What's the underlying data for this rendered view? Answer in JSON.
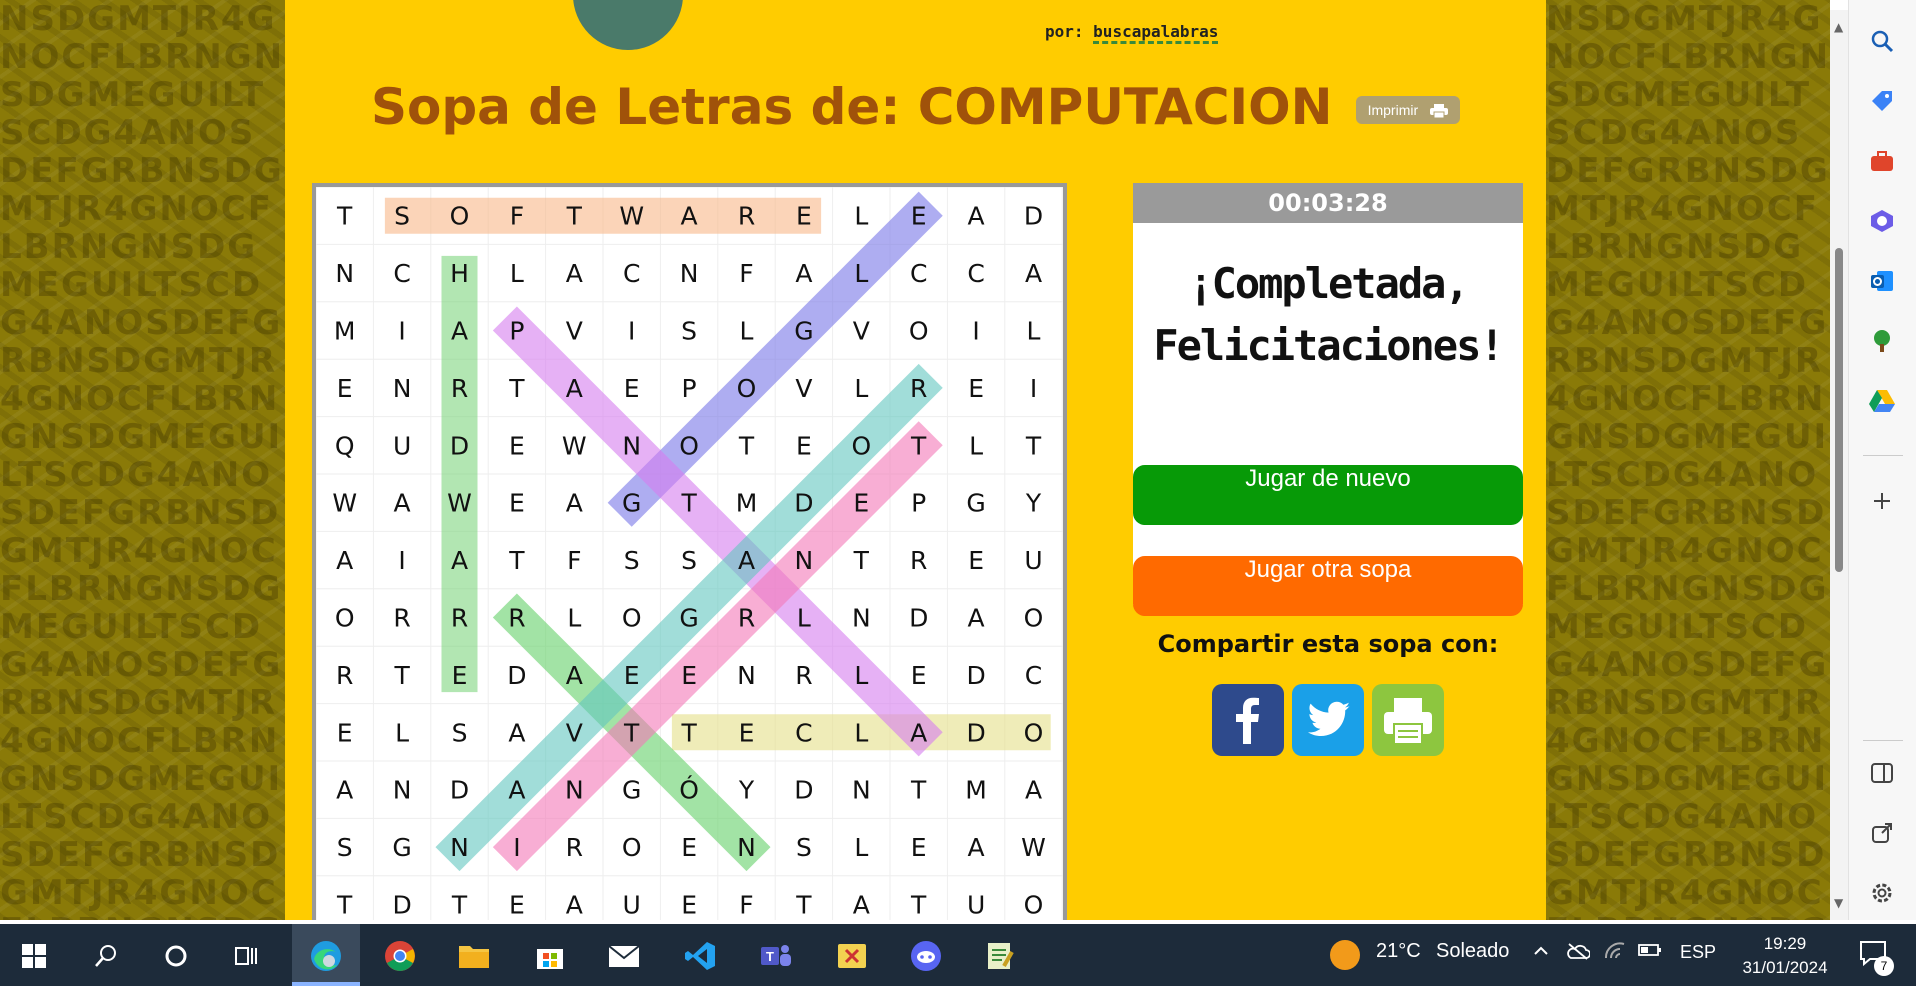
{
  "logo": {
    "by_label": "por:",
    "brand": "buscapalabras"
  },
  "title": "Sopa de Letras de: COMPUTACION",
  "print_button": "Imprimir",
  "grid": {
    "rows": [
      [
        "T",
        "S",
        "O",
        "F",
        "T",
        "W",
        "A",
        "R",
        "E",
        "L",
        "E",
        "A",
        "D"
      ],
      [
        "N",
        "C",
        "H",
        "L",
        "A",
        "C",
        "N",
        "F",
        "A",
        "L",
        "C",
        "C",
        "A"
      ],
      [
        "M",
        "I",
        "A",
        "P",
        "V",
        "I",
        "S",
        "L",
        "G",
        "V",
        "O",
        "I",
        "L"
      ],
      [
        "E",
        "N",
        "R",
        "T",
        "A",
        "E",
        "P",
        "O",
        "V",
        "L",
        "R",
        "E",
        "I"
      ],
      [
        "Q",
        "U",
        "D",
        "E",
        "W",
        "N",
        "O",
        "T",
        "E",
        "O",
        "T",
        "L",
        "T"
      ],
      [
        "W",
        "A",
        "W",
        "E",
        "A",
        "G",
        "T",
        "M",
        "D",
        "E",
        "P",
        "G",
        "Y"
      ],
      [
        "A",
        "I",
        "A",
        "T",
        "F",
        "S",
        "S",
        "A",
        "N",
        "T",
        "R",
        "E",
        "U"
      ],
      [
        "O",
        "R",
        "R",
        "R",
        "L",
        "O",
        "G",
        "R",
        "L",
        "N",
        "D",
        "A",
        "O"
      ],
      [
        "R",
        "T",
        "E",
        "D",
        "A",
        "E",
        "E",
        "N",
        "R",
        "L",
        "E",
        "D",
        "C"
      ],
      [
        "E",
        "L",
        "S",
        "A",
        "V",
        "T",
        "T",
        "E",
        "C",
        "L",
        "A",
        "D",
        "O"
      ],
      [
        "A",
        "N",
        "D",
        "A",
        "N",
        "G",
        "Ó",
        "Y",
        "D",
        "N",
        "T",
        "M",
        "A"
      ],
      [
        "S",
        "G",
        "N",
        "I",
        "R",
        "O",
        "E",
        "N",
        "S",
        "L",
        "E",
        "A",
        "W"
      ],
      [
        "T",
        "D",
        "T",
        "E",
        "A",
        "U",
        "E",
        "F",
        "T",
        "A",
        "T",
        "U",
        "O"
      ]
    ],
    "highlights": [
      {
        "word": "SOFTWARE",
        "from": [
          0,
          1
        ],
        "to": [
          0,
          8
        ],
        "color": "#f9b98a"
      },
      {
        "word": "HARDWARE",
        "from": [
          1,
          2
        ],
        "to": [
          8,
          2
        ],
        "color": "#7fd67f"
      },
      {
        "word": "TECLADO",
        "from": [
          9,
          6
        ],
        "to": [
          9,
          12
        ],
        "color": "#e6e08a"
      },
      {
        "word": "GOOGLE",
        "from": [
          5,
          5
        ],
        "to": [
          0,
          10
        ],
        "color": "#7a78e8"
      },
      {
        "word": "PANTALLA",
        "from": [
          2,
          3
        ],
        "to": [
          9,
          10
        ],
        "color": "#d77ef0"
      },
      {
        "word": "RED",
        "from": [
          7,
          3
        ],
        "to": [
          11,
          7
        ],
        "color": "#66d26a"
      },
      {
        "word": "NAVEGADOR",
        "from": [
          11,
          2
        ],
        "to": [
          3,
          10
        ],
        "color": "#63c8c0"
      },
      {
        "word": "INTERNET",
        "from": [
          11,
          3
        ],
        "to": [
          4,
          10
        ],
        "color": "#f47ab8"
      }
    ]
  },
  "timer": "00:03:28",
  "completed_line1": "¡Completada,",
  "completed_line2": "Felicitaciones!",
  "play_again": "Jugar de nuevo",
  "play_other": "Jugar otra sopa",
  "share_label": "Compartir esta sopa con:",
  "social": {
    "facebook_icon": "facebook-icon",
    "twitter_icon": "twitter-icon",
    "print_icon": "printer-icon"
  },
  "taskbar": {
    "weather_temp": "21°C",
    "weather_desc": "Soleado",
    "language": "ESP",
    "time": "19:29",
    "date": "31/01/2024",
    "notifications": "7"
  },
  "colors": {
    "page_bg": "#ffcc00",
    "title": "#a0520a",
    "green_button": "#079a07",
    "orange_button": "#ff6a00"
  }
}
